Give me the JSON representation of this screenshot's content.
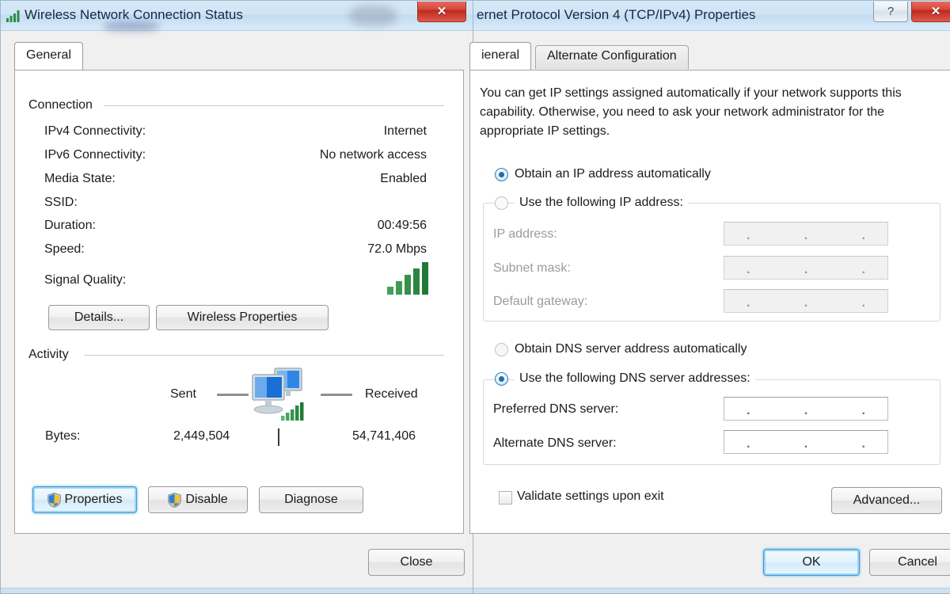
{
  "status_window": {
    "title": "Wireless Network Connection Status",
    "title_icon": "wireless-signal-icon",
    "close_label": "✕",
    "tabs": [
      {
        "label": "General",
        "selected": true
      }
    ],
    "connection_group": {
      "legend": "Connection",
      "rows": [
        {
          "label": "IPv4 Connectivity:",
          "value": "Internet"
        },
        {
          "label": "IPv6 Connectivity:",
          "value": "No network access"
        },
        {
          "label": "Media State:",
          "value": "Enabled"
        },
        {
          "label": "SSID:",
          "value": ""
        },
        {
          "label": "Duration:",
          "value": "00:49:56"
        },
        {
          "label": "Speed:",
          "value": "72.0 Mbps"
        },
        {
          "label": "Signal Quality:",
          "value": ""
        }
      ],
      "signal_bars": 5,
      "signal_icon": "signal-bars-icon",
      "buttons": [
        {
          "label": "Details...",
          "name": "details-button"
        },
        {
          "label": "Wireless Properties",
          "name": "wireless-properties-button"
        }
      ]
    },
    "activity_group": {
      "legend": "Activity",
      "sent_label": "Sent",
      "received_label": "Received",
      "center_icon": "network-computers-icon",
      "bytes_label": "Bytes:",
      "bytes_sent": "2,449,504",
      "bytes_received": "54,741,406"
    },
    "action_buttons": [
      {
        "label": "Properties",
        "name": "properties-button",
        "icon": "uac-shield-icon",
        "focused": true
      },
      {
        "label": "Disable",
        "name": "disable-button",
        "icon": "uac-shield-icon",
        "focused": false
      },
      {
        "label": "Diagnose",
        "name": "diagnose-button",
        "icon": null,
        "focused": false
      }
    ],
    "close_button_label": "Close"
  },
  "tcpip_window": {
    "title": "ernet Protocol Version 4 (TCP/IPv4) Properties",
    "help_label": "?",
    "close_label": "✕",
    "tabs": [
      {
        "label": "General",
        "selected": true,
        "clipped_label": "ieneral"
      },
      {
        "label": "Alternate Configuration",
        "selected": false
      }
    ],
    "description": "You can get IP settings assigned automatically if your network supports this capability. Otherwise, you need to ask your network administrator for the appropriate IP settings.",
    "ip_section": {
      "auto_option": {
        "label": "Obtain an IP address automatically",
        "selected": true
      },
      "manual_option": {
        "label": "Use the following IP address:",
        "selected": false
      },
      "fields": [
        {
          "label": "IP address:",
          "value": "",
          "disabled": true
        },
        {
          "label": "Subnet mask:",
          "value": "",
          "disabled": true
        },
        {
          "label": "Default gateway:",
          "value": "",
          "disabled": true
        }
      ]
    },
    "dns_section": {
      "auto_option": {
        "label": "Obtain DNS server address automatically",
        "selected": false
      },
      "manual_option": {
        "label": "Use the following DNS server addresses:",
        "selected": true
      },
      "fields": [
        {
          "label": "Preferred DNS server:",
          "value": "",
          "disabled": false
        },
        {
          "label": "Alternate DNS server:",
          "value": "",
          "disabled": false
        }
      ]
    },
    "validate_checkbox": {
      "label": "Validate settings upon exit",
      "checked": false
    },
    "advanced_button": "Advanced...",
    "ok_button": "OK",
    "cancel_button": "Cancel"
  },
  "colors": {
    "titlebar": "#cfe4f5",
    "close_red": "#d6473a",
    "focus_blue": "#3c9bdc",
    "signal_green": "#2e8b45",
    "monitor_blue": "#1a6fd4"
  }
}
